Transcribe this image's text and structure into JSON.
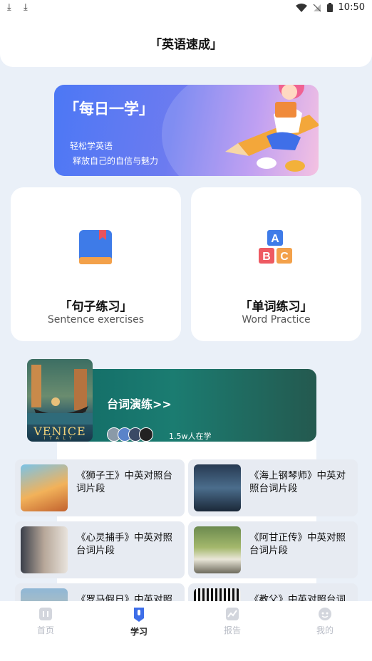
{
  "status_bar": {
    "time": "10:50"
  },
  "header": {
    "title": "「英语速成」"
  },
  "banner": {
    "title": "「每日一学」",
    "line1": "轻松学英语",
    "line2": "释放自己的自信与魅力"
  },
  "cards": [
    {
      "title": "「句子练习」",
      "subtitle": "Sentence exercises"
    },
    {
      "title": "「单词练习」",
      "subtitle": "Word Practice"
    }
  ],
  "movie_section": {
    "title": "台词演练>>",
    "learners": "1.5w人在学",
    "poster_text": "VENICE",
    "poster_sub": "ITALY"
  },
  "items": [
    {
      "title": "《狮子王》中英对照台词片段"
    },
    {
      "title": "《海上钢琴师》中英对照台词片段"
    },
    {
      "title": "《心灵捕手》中英对照台词片段"
    },
    {
      "title": "《阿甘正传》中英对照台词片段"
    },
    {
      "title": "《罗马假日》中英对照台词片段"
    },
    {
      "title": "《教父》中英对照台词片段"
    }
  ],
  "tabs": [
    {
      "label": "首页",
      "icon": "home-icon"
    },
    {
      "label": "学习",
      "icon": "study-icon"
    },
    {
      "label": "报告",
      "icon": "chart-icon"
    },
    {
      "label": "我的",
      "icon": "profile-icon"
    }
  ],
  "colors": {
    "accent": "#4c78f5",
    "background": "#eaf0f8",
    "teal": "#1b7c71"
  }
}
